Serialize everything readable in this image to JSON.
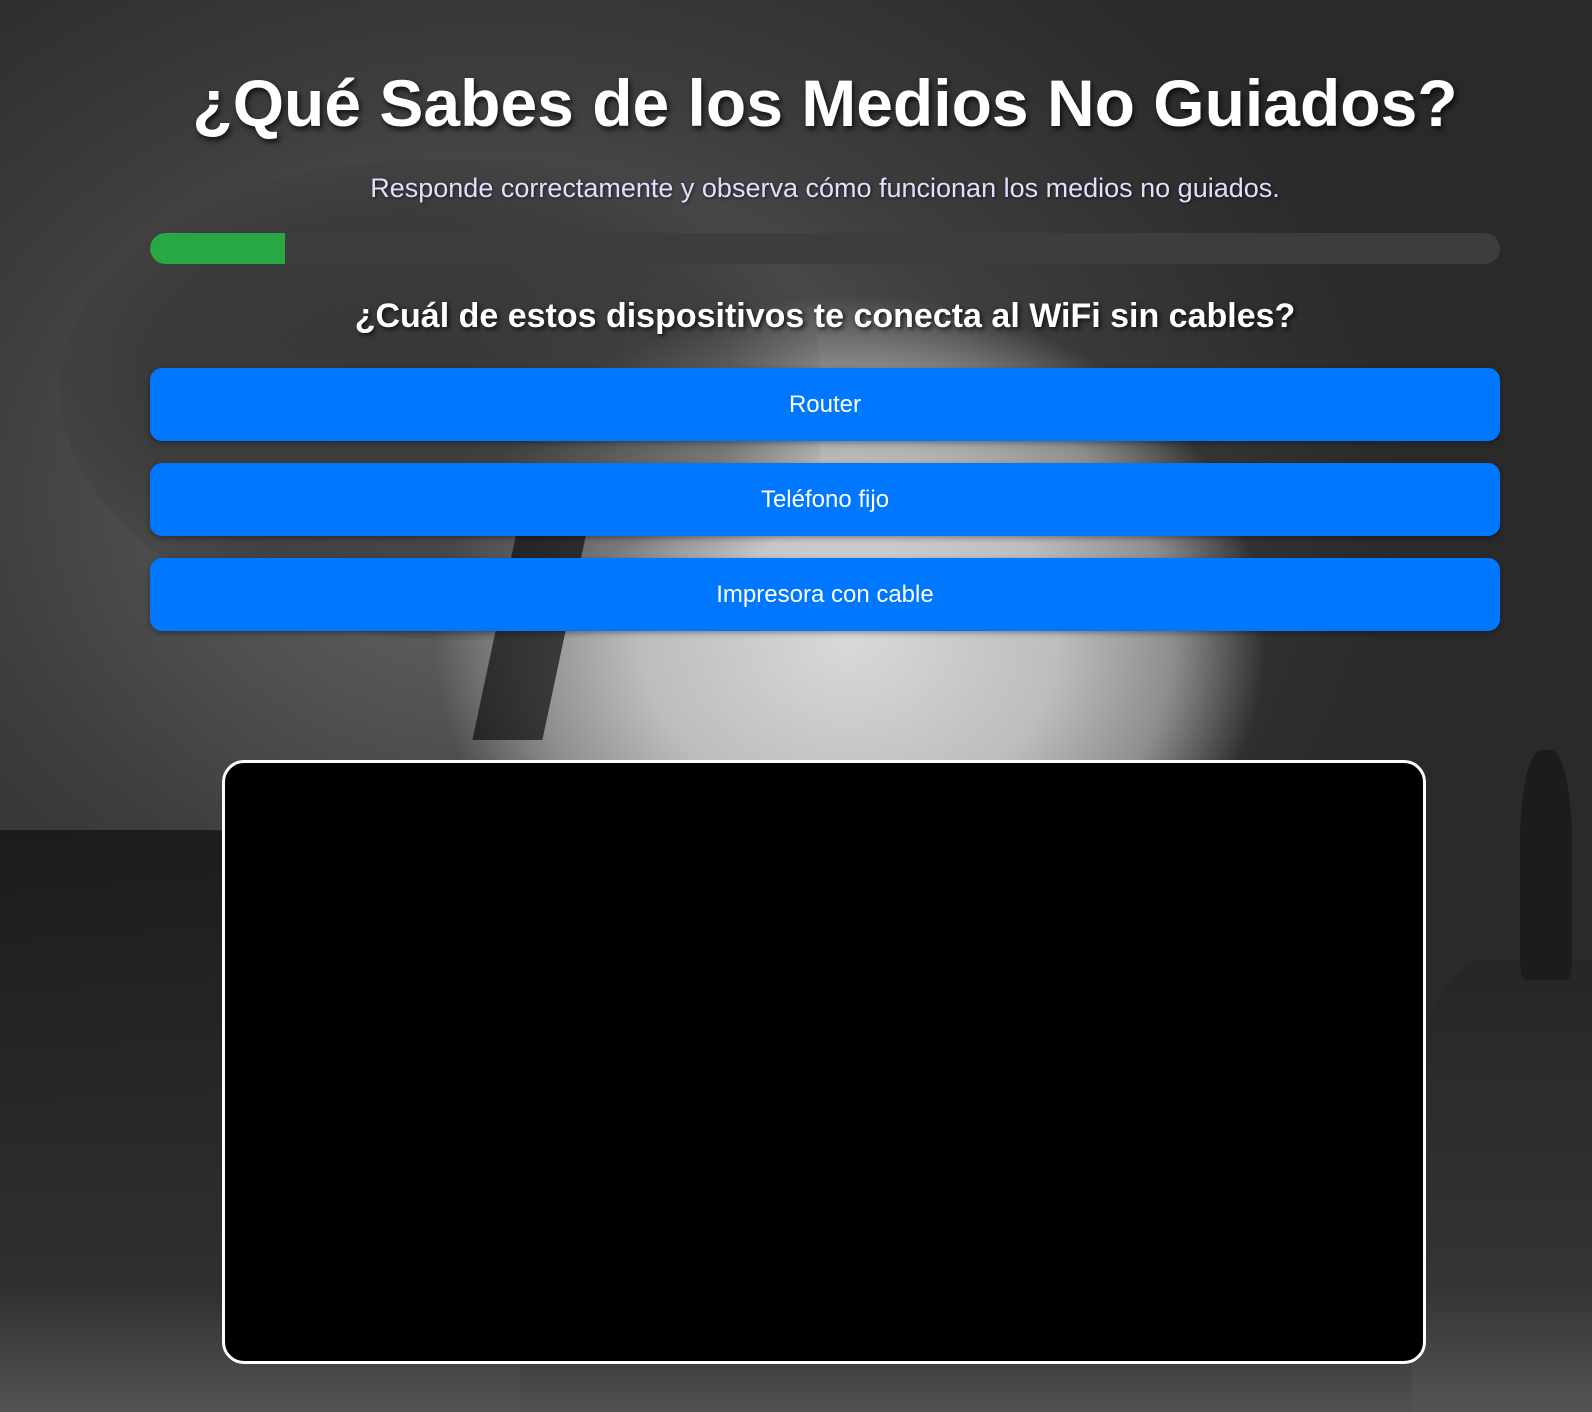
{
  "header": {
    "title": "¿Qué Sabes de los Medios No Guiados?",
    "subtitle": "Responde correctamente y observa cómo funcionan los medios no guiados."
  },
  "progress": {
    "fraction": 0.1,
    "fill_color": "#28a745",
    "track_color": "#3d3d3d"
  },
  "quiz": {
    "question": "¿Cuál de estos dispositivos te conecta al WiFi sin cables?",
    "options": [
      {
        "label": "Router"
      },
      {
        "label": "Teléfono fijo"
      },
      {
        "label": "Impresora con cable"
      }
    ],
    "button_color": "#0077ff"
  },
  "media": {
    "background_color": "#000000",
    "border_color": "#ffffff"
  }
}
